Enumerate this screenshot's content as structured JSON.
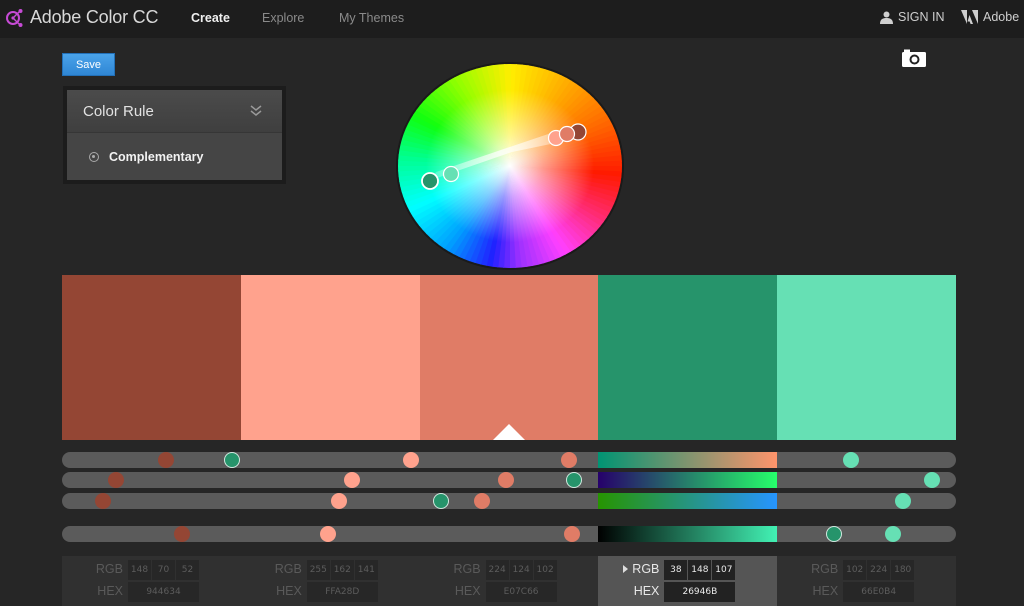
{
  "header": {
    "app_title": "Adobe Color CC",
    "nav": [
      {
        "label": "Create",
        "active": true
      },
      {
        "label": "Explore",
        "active": false
      },
      {
        "label": "My Themes",
        "active": false
      }
    ],
    "sign_in": "SIGN IN",
    "adobe": "Adobe",
    "logo_color": "#c74bd6"
  },
  "toolbar": {
    "save_label": "Save"
  },
  "color_rule": {
    "title": "Color Rule",
    "selected": "Complementary"
  },
  "theme": {
    "active_index": 3,
    "base_index": 2,
    "swatches": [
      {
        "hex": "944634",
        "rgb": [
          148,
          70,
          52
        ],
        "color": "#944634"
      },
      {
        "hex": "FFA28D",
        "rgb": [
          255,
          162,
          141
        ],
        "color": "#FFA28D"
      },
      {
        "hex": "E07C66",
        "rgb": [
          224,
          124,
          102
        ],
        "color": "#E07C66"
      },
      {
        "hex": "26946B",
        "rgb": [
          38,
          148,
          107
        ],
        "color": "#26946B"
      },
      {
        "hex": "66E0B4",
        "rgb": [
          102,
          224,
          180
        ],
        "color": "#66E0B4"
      }
    ]
  },
  "sliders": {
    "rows": [
      {
        "name": "red",
        "fractions": [
          0.116,
          0.39,
          0.567,
          0.19,
          0.883
        ]
      },
      {
        "name": "green",
        "fractions": [
          0.06,
          0.324,
          0.497,
          0.573,
          0.973
        ]
      },
      {
        "name": "blue",
        "fractions": [
          0.046,
          0.31,
          0.47,
          0.424,
          0.941
        ]
      },
      {
        "name": "brightness",
        "fractions": [
          0.134,
          0.297,
          0.57,
          0.864,
          0.93
        ]
      }
    ],
    "active_gradients": [
      "linear-gradient(90deg,#009473,#ff946b)",
      "linear-gradient(90deg,#26006b,#26ff6b)",
      "linear-gradient(90deg,#269400,#2694ff)",
      "linear-gradient(90deg,#000000,#42f2b4)"
    ]
  },
  "values": {
    "rgb_label": "RGB",
    "hex_label": "HEX"
  }
}
